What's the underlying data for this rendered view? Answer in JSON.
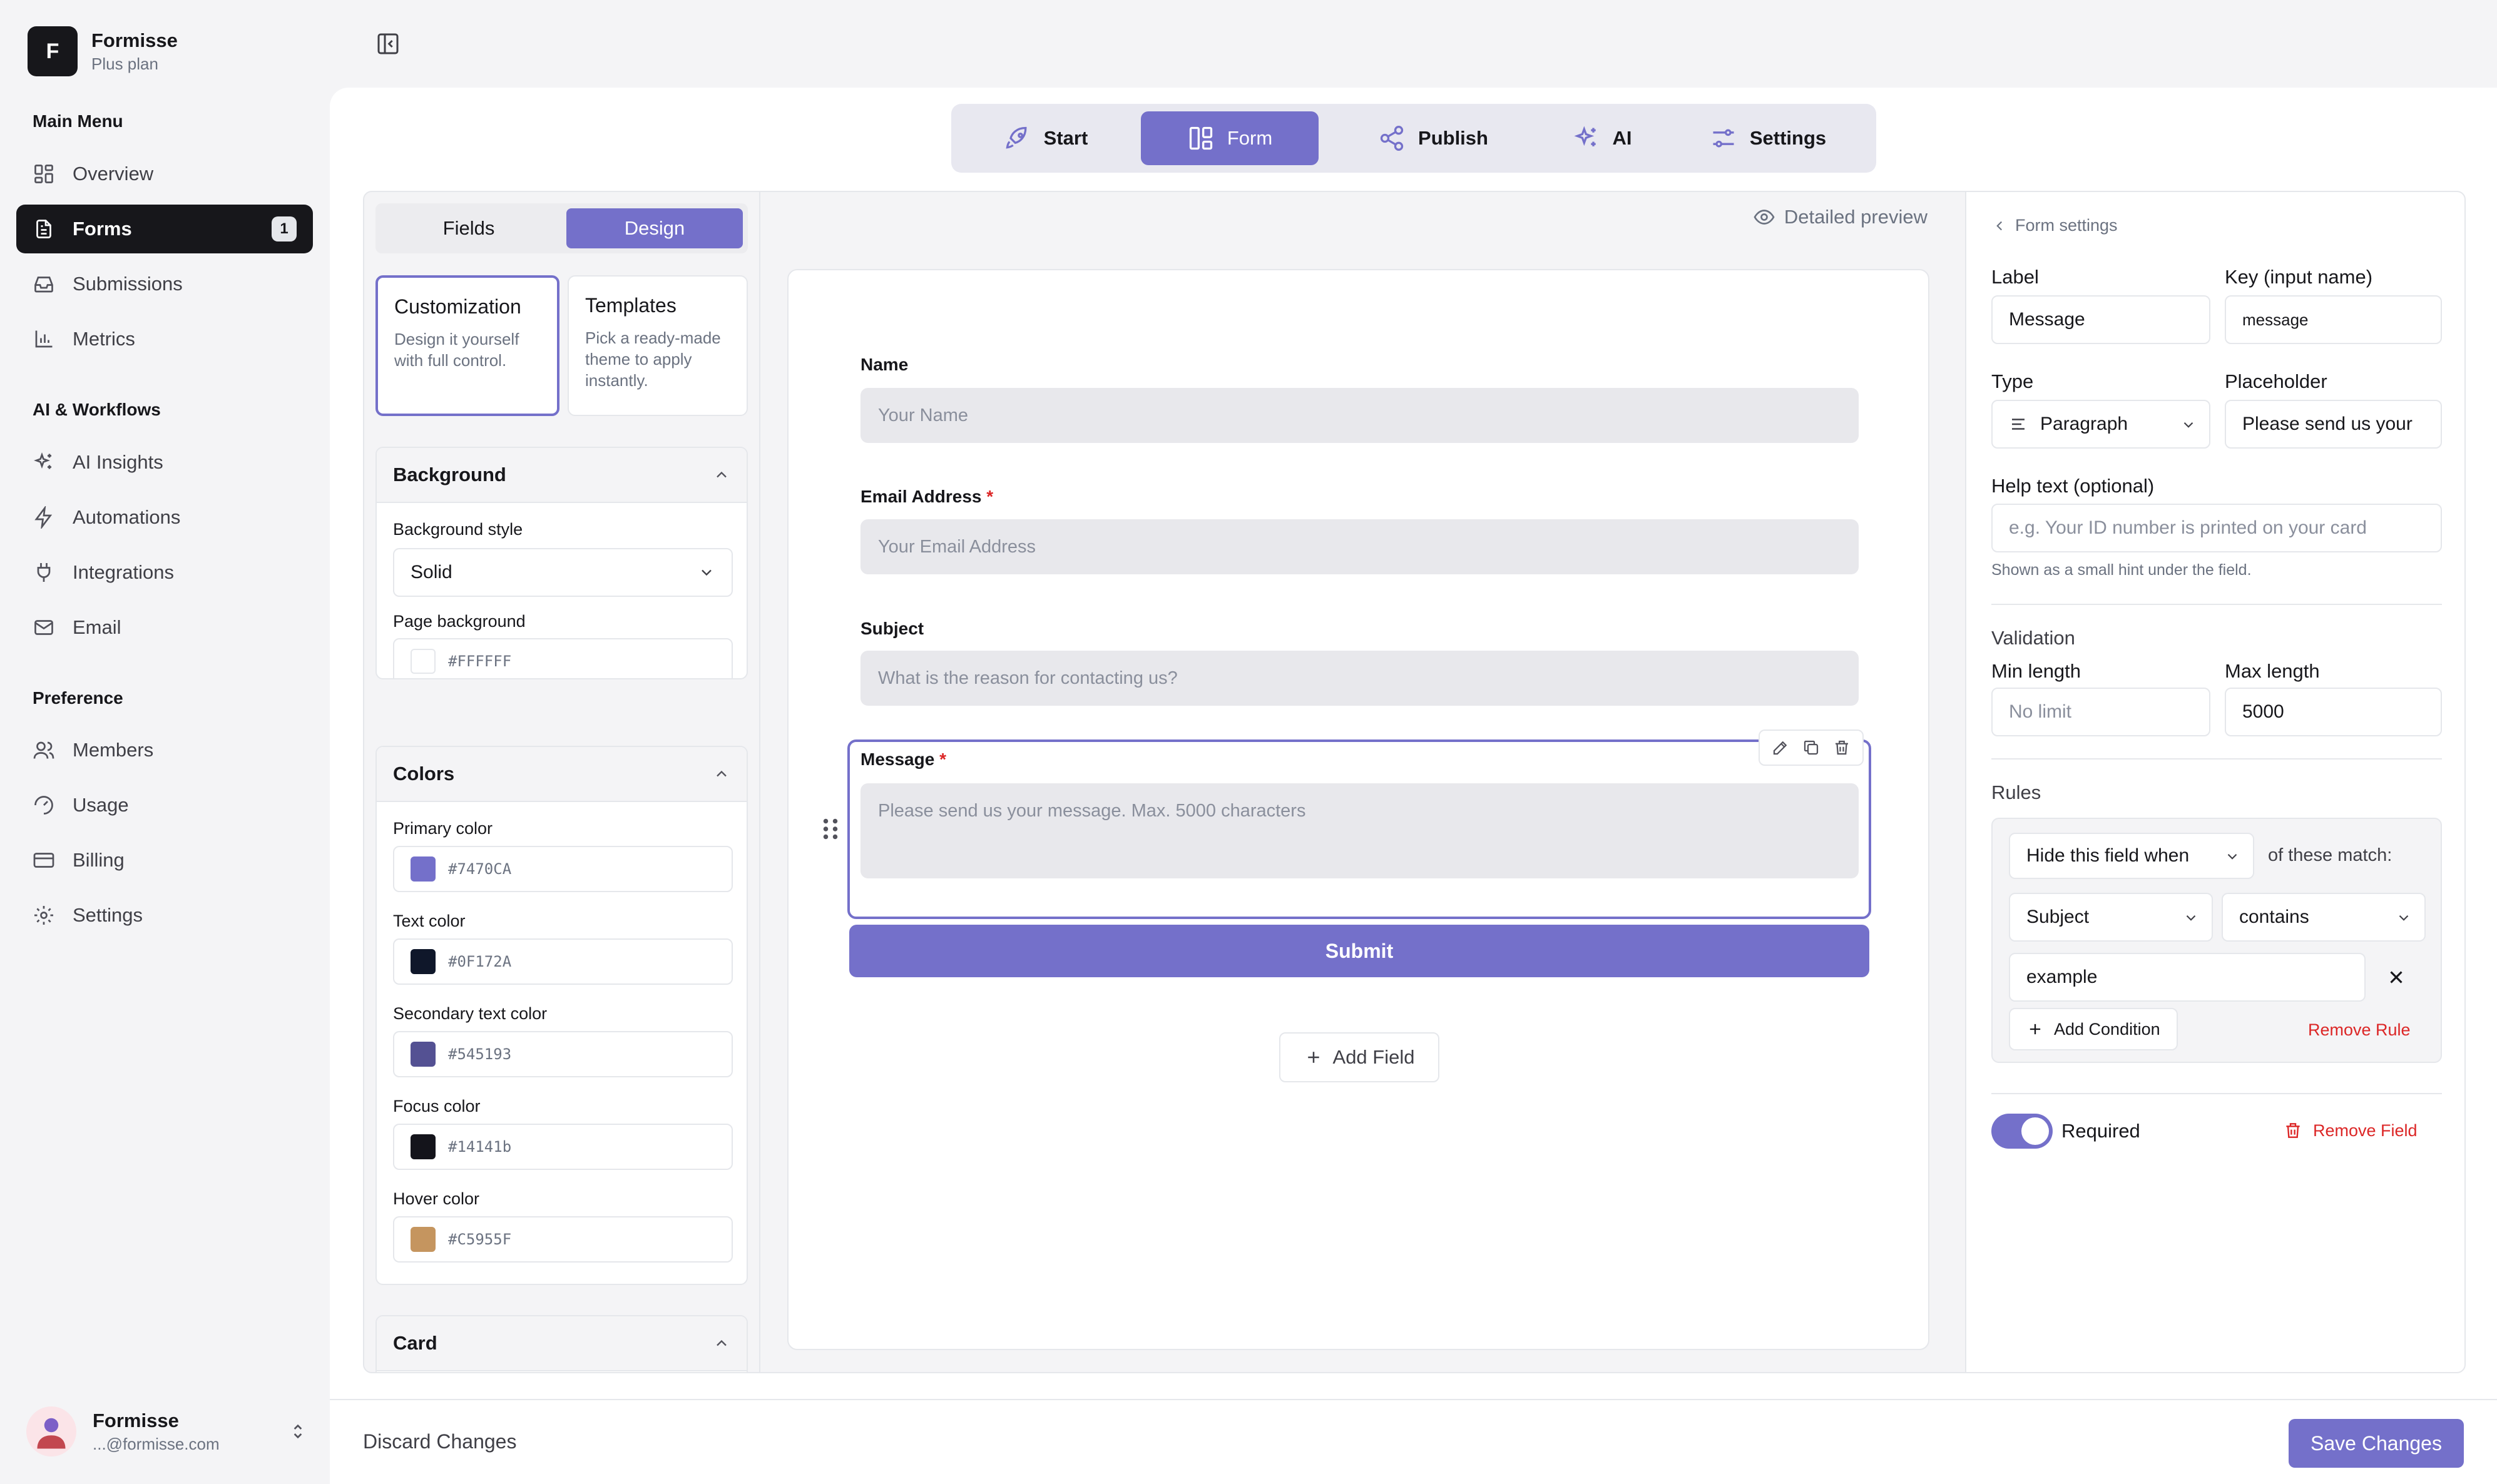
{
  "brand": {
    "logo_letter": "F",
    "name": "Formisse",
    "plan": "Plus plan"
  },
  "sidebar": {
    "sections": {
      "main": "Main Menu",
      "ai": "AI & Workflows",
      "preference": "Preference"
    },
    "items": [
      {
        "label": "Overview",
        "icon": "grid-icon"
      },
      {
        "label": "Forms",
        "icon": "document-icon",
        "badge": "1",
        "active": true
      },
      {
        "label": "Submissions",
        "icon": "inbox-icon"
      },
      {
        "label": "Metrics",
        "icon": "bar-chart-icon"
      },
      {
        "label": "AI Insights",
        "icon": "sparkles-icon"
      },
      {
        "label": "Automations",
        "icon": "lightning-icon"
      },
      {
        "label": "Integrations",
        "icon": "plug-icon"
      },
      {
        "label": "Email",
        "icon": "mail-icon"
      },
      {
        "label": "Members",
        "icon": "users-icon"
      },
      {
        "label": "Usage",
        "icon": "gauge-icon"
      },
      {
        "label": "Billing",
        "icon": "credit-card-icon"
      },
      {
        "label": "Settings",
        "icon": "gear-icon"
      }
    ]
  },
  "user": {
    "name": "Formisse",
    "email": "...@formisse.com"
  },
  "topnav": [
    {
      "label": "Start",
      "icon": "rocket-icon"
    },
    {
      "label": "Form",
      "icon": "layout-icon",
      "active": true
    },
    {
      "label": "Publish",
      "icon": "share-icon"
    },
    {
      "label": "AI",
      "icon": "sparkles-icon"
    },
    {
      "label": "Settings",
      "icon": "sliders-icon"
    }
  ],
  "left_panel": {
    "tabs": {
      "fields": "Fields",
      "design": "Design"
    },
    "modes": {
      "customization": {
        "title": "Customization",
        "desc": "Design it yourself with full control."
      },
      "templates": {
        "title": "Templates",
        "desc": "Pick a ready-made theme to apply instantly."
      }
    },
    "background": {
      "title": "Background",
      "style_label": "Background style",
      "style_value": "Solid",
      "page_bg_label": "Page background",
      "page_bg_value": "#FFFFFF"
    },
    "colors": {
      "title": "Colors",
      "primary_label": "Primary color",
      "primary_value": "#7470CA",
      "text_label": "Text color",
      "text_value": "#0F172A",
      "secondary_label": "Secondary text color",
      "secondary_value": "#545193",
      "focus_label": "Focus color",
      "focus_value": "#14141b",
      "hover_label": "Hover color",
      "hover_value": "#C5955F"
    },
    "card": {
      "title": "Card"
    }
  },
  "canvas": {
    "preview_label": "Detailed preview",
    "fields": {
      "name": {
        "label": "Name",
        "placeholder": "Your Name"
      },
      "email": {
        "label": "Email Address",
        "required": "*",
        "placeholder": "Your Email Address"
      },
      "subject": {
        "label": "Subject",
        "placeholder": "What is the reason for contacting us?"
      },
      "message": {
        "label": "Message",
        "required": "*",
        "placeholder": "Please send us your message. Max. 5000 characters"
      }
    },
    "submit_label": "Submit",
    "add_field_label": "Add Field"
  },
  "right_panel": {
    "back_label": "Form settings",
    "label_title": "Label",
    "label_value": "Message",
    "key_title": "Key (input name)",
    "key_value": "message",
    "type_title": "Type",
    "type_value": "Paragraph",
    "placeholder_title": "Placeholder",
    "placeholder_value": "Please send us your",
    "help_title": "Help text (optional)",
    "help_placeholder": "e.g. Your ID number is printed on your card",
    "help_hint": "Shown as a small hint under the field.",
    "validation_title": "Validation",
    "min_title": "Min length",
    "min_placeholder": "No limit",
    "max_title": "Max length",
    "max_value": "5000",
    "rules_title": "Rules",
    "rule": {
      "action": "Hide this field when",
      "match_text": "of these match:",
      "field": "Subject",
      "operator": "contains",
      "value": "example"
    },
    "add_condition_label": "Add Condition",
    "remove_rule_label": "Remove Rule",
    "required_label": "Required",
    "remove_field_label": "Remove Field"
  },
  "footer": {
    "discard_label": "Discard Changes",
    "save_label": "Save Changes"
  }
}
